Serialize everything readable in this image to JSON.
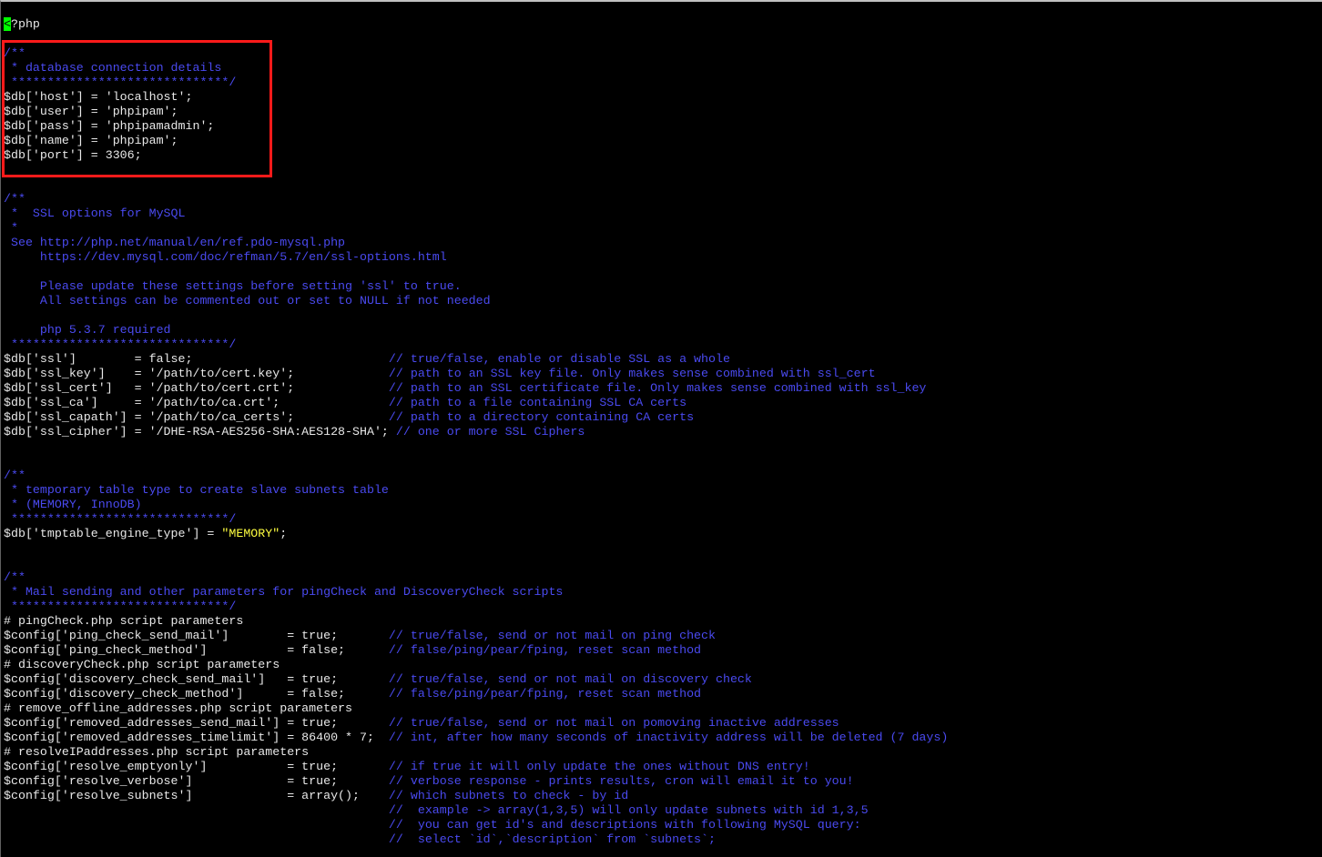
{
  "terminal": {
    "colors": {
      "background": "#000000",
      "text": "#e8e8e8",
      "comment": "#4a4af0",
      "string": "#ffff40",
      "cursor": "#00ff00",
      "highlight_box": "#ff1a1a"
    },
    "lines": [
      [
        {
          "t": "<",
          "c": "cursor"
        },
        {
          "t": "?php",
          "c": "text"
        }
      ],
      [],
      [
        {
          "t": "/**",
          "c": "comment"
        }
      ],
      [
        {
          "t": " * database connection details",
          "c": "comment"
        }
      ],
      [
        {
          "t": " ******************************/",
          "c": "comment"
        }
      ],
      [
        {
          "t": "$db['host'] = 'localhost';",
          "c": "text"
        }
      ],
      [
        {
          "t": "$db['user'] = 'phpipam';",
          "c": "text"
        }
      ],
      [
        {
          "t": "$db['pass'] = 'phpipamadmin';",
          "c": "text"
        }
      ],
      [
        {
          "t": "$db['name'] = 'phpipam';",
          "c": "text"
        }
      ],
      [
        {
          "t": "$db['port'] = 3306;",
          "c": "text"
        }
      ],
      [],
      [],
      [
        {
          "t": "/**",
          "c": "comment"
        }
      ],
      [
        {
          "t": " *  SSL options for MySQL",
          "c": "comment"
        }
      ],
      [
        {
          "t": " *",
          "c": "comment"
        }
      ],
      [
        {
          "t": " See http://php.net/manual/en/ref.pdo-mysql.php",
          "c": "comment"
        }
      ],
      [
        {
          "t": "     https://dev.mysql.com/doc/refman/5.7/en/ssl-options.html",
          "c": "comment"
        }
      ],
      [],
      [
        {
          "t": "     Please update these settings before setting 'ssl' to true.",
          "c": "comment"
        }
      ],
      [
        {
          "t": "     All settings can be commented out or set to NULL if not needed",
          "c": "comment"
        }
      ],
      [],
      [
        {
          "t": "     php 5.3.7 required",
          "c": "comment"
        }
      ],
      [
        {
          "t": " ******************************/",
          "c": "comment"
        }
      ],
      [
        {
          "t": "$db['ssl']        = false;                           ",
          "c": "text"
        },
        {
          "t": "// true/false, enable or disable SSL as a whole",
          "c": "comment"
        }
      ],
      [
        {
          "t": "$db['ssl_key']    = '/path/to/cert.key';             ",
          "c": "text"
        },
        {
          "t": "// path to an SSL key file. Only makes sense combined with ssl_cert",
          "c": "comment"
        }
      ],
      [
        {
          "t": "$db['ssl_cert']   = '/path/to/cert.crt';             ",
          "c": "text"
        },
        {
          "t": "// path to an SSL certificate file. Only makes sense combined with ssl_key",
          "c": "comment"
        }
      ],
      [
        {
          "t": "$db['ssl_ca']     = '/path/to/ca.crt';               ",
          "c": "text"
        },
        {
          "t": "// path to a file containing SSL CA certs",
          "c": "comment"
        }
      ],
      [
        {
          "t": "$db['ssl_capath'] = '/path/to/ca_certs';             ",
          "c": "text"
        },
        {
          "t": "// path to a directory containing CA certs",
          "c": "comment"
        }
      ],
      [
        {
          "t": "$db['ssl_cipher'] = '/DHE-RSA-AES256-SHA:AES128-SHA'; ",
          "c": "text"
        },
        {
          "t": "// one or more SSL Ciphers",
          "c": "comment"
        }
      ],
      [],
      [],
      [
        {
          "t": "/**",
          "c": "comment"
        }
      ],
      [
        {
          "t": " * temporary table type to create slave subnets table",
          "c": "comment"
        }
      ],
      [
        {
          "t": " * (MEMORY, InnoDB)",
          "c": "comment"
        }
      ],
      [
        {
          "t": " ******************************/",
          "c": "comment"
        }
      ],
      [
        {
          "t": "$db['tmptable_engine_type'] = ",
          "c": "text"
        },
        {
          "t": "\"MEMORY\"",
          "c": "string"
        },
        {
          "t": ";",
          "c": "text"
        }
      ],
      [],
      [],
      [
        {
          "t": "/**",
          "c": "comment"
        }
      ],
      [
        {
          "t": " * Mail sending and other parameters for pingCheck and DiscoveryCheck scripts",
          "c": "comment"
        }
      ],
      [
        {
          "t": " ******************************/",
          "c": "comment"
        }
      ],
      [
        {
          "t": "# pingCheck.php script parameters",
          "c": "text"
        }
      ],
      [
        {
          "t": "$config['ping_check_send_mail']        = true;       ",
          "c": "text"
        },
        {
          "t": "// true/false, send or not mail on ping check",
          "c": "comment"
        }
      ],
      [
        {
          "t": "$config['ping_check_method']           = false;      ",
          "c": "text"
        },
        {
          "t": "// false/ping/pear/fping, reset scan method",
          "c": "comment"
        }
      ],
      [
        {
          "t": "# discoveryCheck.php script parameters",
          "c": "text"
        }
      ],
      [
        {
          "t": "$config['discovery_check_send_mail']   = true;       ",
          "c": "text"
        },
        {
          "t": "// true/false, send or not mail on discovery check",
          "c": "comment"
        }
      ],
      [
        {
          "t": "$config['discovery_check_method']      = false;      ",
          "c": "text"
        },
        {
          "t": "// false/ping/pear/fping, reset scan method",
          "c": "comment"
        }
      ],
      [
        {
          "t": "# remove_offline_addresses.php script parameters",
          "c": "text"
        }
      ],
      [
        {
          "t": "$config['removed_addresses_send_mail'] = true;       ",
          "c": "text"
        },
        {
          "t": "// true/false, send or not mail on pomoving inactive addresses",
          "c": "comment"
        }
      ],
      [
        {
          "t": "$config['removed_addresses_timelimit'] = 86400 * 7;  ",
          "c": "text"
        },
        {
          "t": "// int, after how many seconds of inactivity address will be deleted (7 days)",
          "c": "comment"
        }
      ],
      [
        {
          "t": "# resolveIPaddresses.php script parameters",
          "c": "text"
        }
      ],
      [
        {
          "t": "$config['resolve_emptyonly']           = true;       ",
          "c": "text"
        },
        {
          "t": "// if true it will only update the ones without DNS entry!",
          "c": "comment"
        }
      ],
      [
        {
          "t": "$config['resolve_verbose']             = true;       ",
          "c": "text"
        },
        {
          "t": "// verbose response - prints results, cron will email it to you!",
          "c": "comment"
        }
      ],
      [
        {
          "t": "$config['resolve_subnets']             = array();    ",
          "c": "text"
        },
        {
          "t": "// which subnets to check - by id",
          "c": "comment"
        }
      ],
      [
        {
          "t": "                                                     ",
          "c": "text"
        },
        {
          "t": "//  example -> array(1,3,5) will only update subnets with id 1,3,5",
          "c": "comment"
        }
      ],
      [
        {
          "t": "                                                     ",
          "c": "text"
        },
        {
          "t": "//  you can get id's and descriptions with following MySQL query:",
          "c": "comment"
        }
      ],
      [
        {
          "t": "                                                     ",
          "c": "text"
        },
        {
          "t": "//  select `id`,`description` from `subnets`;",
          "c": "comment"
        }
      ]
    ]
  }
}
